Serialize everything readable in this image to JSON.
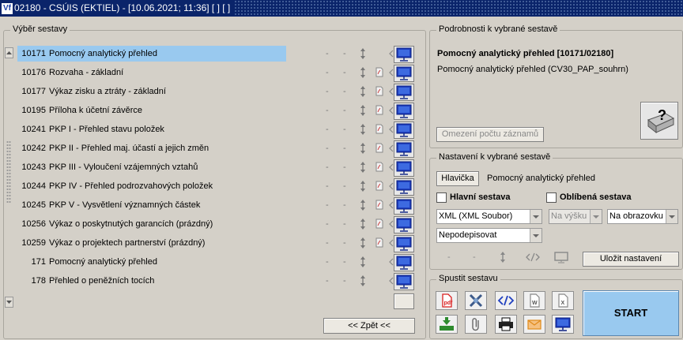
{
  "titlebar": {
    "text": "02180 - CSÚIS (EKTIEL) - [10.06.2021; 11:36]  [ ]  [ ]",
    "icon": "app-logo-icon"
  },
  "selection": {
    "legend": "Výběr sestavy",
    "rows": [
      {
        "code": "10171",
        "name": "Pomocný analytický přehled",
        "selected": true,
        "pdf": false
      },
      {
        "code": "10176",
        "name": "Rozvaha - základní",
        "pdf": true
      },
      {
        "code": "10177",
        "name": "Výkaz zisku a ztráty - základní",
        "pdf": true
      },
      {
        "code": "10195",
        "name": "Příloha k účetní závěrce",
        "pdf": true
      },
      {
        "code": "10241",
        "name": "PKP I - Přehled stavu položek",
        "pdf": true
      },
      {
        "code": "10242",
        "name": "PKP II - Přehled maj. účastí a jejich změn",
        "pdf": true
      },
      {
        "code": "10243",
        "name": "PKP III - Vyloučení vzájemných vztahů",
        "pdf": true
      },
      {
        "code": "10244",
        "name": "PKP IV - Přehled podrozvahových položek",
        "pdf": true
      },
      {
        "code": "10245",
        "name": "PKP V - Vysvětlení významných částek",
        "pdf": true
      },
      {
        "code": "10256",
        "name": "Výkaz o poskytnutých garancích (prázdný)",
        "pdf": true
      },
      {
        "code": "10259",
        "name": "Výkaz o projektech partnerství (prázdný)",
        "pdf": true
      },
      {
        "code": "171",
        "name": "Pomocný analytický přehled",
        "pdf": false
      },
      {
        "code": "178",
        "name": "Přehled o peněžních tocích",
        "pdf": false
      }
    ],
    "dash": "-",
    "back_label": "<< Zpět <<"
  },
  "details": {
    "legend": "Podrobnosti k vybrané sestavě",
    "title": "Pomocný analytický přehled [10171/02180]",
    "subtitle": "Pomocný analytický přehled (CV30_PAP_souhrn)",
    "limit_label": "Omezení počtu záznamů"
  },
  "settings": {
    "legend": "Nastavení k vybrané sestavě",
    "header_button": "Hlavička",
    "header_value": "Pomocný analytický přehled",
    "main_label": "Hlavní sestava",
    "favorite_label": "Oblíbená sestava",
    "format": "XML (XML Soubor)",
    "orientation": "Na výšku",
    "output": "Na obrazovku",
    "sign": "Nepodepisovat",
    "dash": "-",
    "save_label": "Uložit nastavení"
  },
  "run": {
    "legend": "Spustit sestavu",
    "start_label": "START"
  },
  "colors": {
    "accent": "#0a246a",
    "selection": "#99c9ef",
    "start": "#99c9ef",
    "pdf": "#d92020",
    "icon_blue": "#1f3fbf"
  }
}
